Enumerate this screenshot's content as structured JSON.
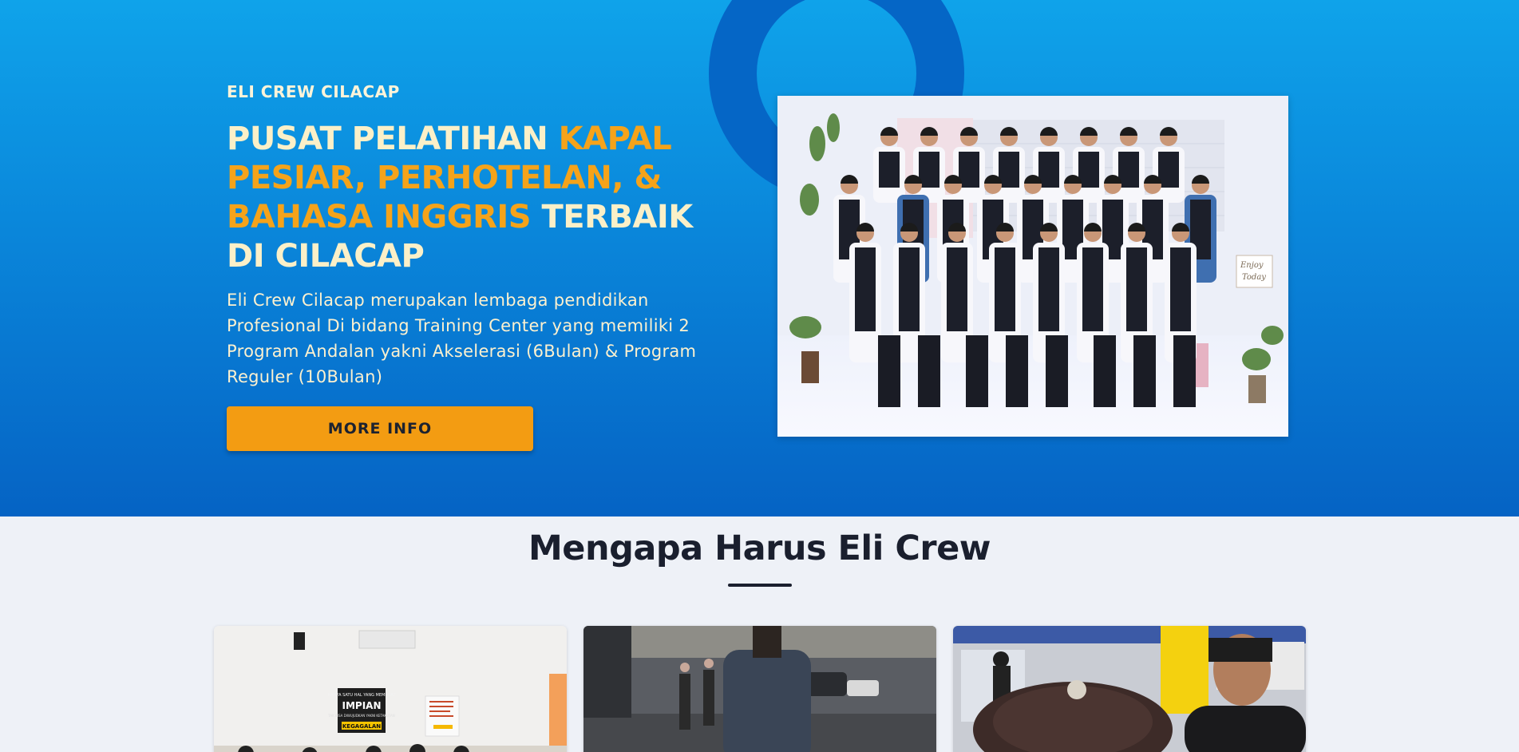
{
  "hero": {
    "eyebrow": "ELI CREW CILACAP",
    "headline": {
      "part1": "PUSAT PELATIHAN ",
      "highlight": "KAPAL PESIAR, PERHOTELAN, & BAHASA INGGRIS",
      "part2": " TERBAIK DI CILACAP"
    },
    "description": "Eli Crew Cilacap merupakan lembaga pendidikan Profesional Di bidang Training Center yang memiliki 2 Program Andalan yakni Akselerasi (6Bulan) & Program Reguler (10Bulan)",
    "button_label": "MORE INFO",
    "photo_sign": {
      "line1": "Enjoy",
      "line2": "Today"
    }
  },
  "section": {
    "title": "Mengapa Harus Eli Crew"
  },
  "cards": [
    {
      "poster_top": "HANYA SATU HAL YANG MEMBUAT",
      "poster_main": "IMPIAN",
      "poster_mid": "TAK BISA DIWUJUDKAN YAKNI KETAKUTAN",
      "poster_bottom": "KEGAGALAN"
    },
    {},
    {}
  ],
  "colors": {
    "hero_top": "#0fa3ea",
    "hero_bottom": "#0563c4",
    "accent": "#f5a31a",
    "headline_text": "#fbf0c8",
    "section_bg": "#eef1f7",
    "title_text": "#1a1f2e"
  }
}
